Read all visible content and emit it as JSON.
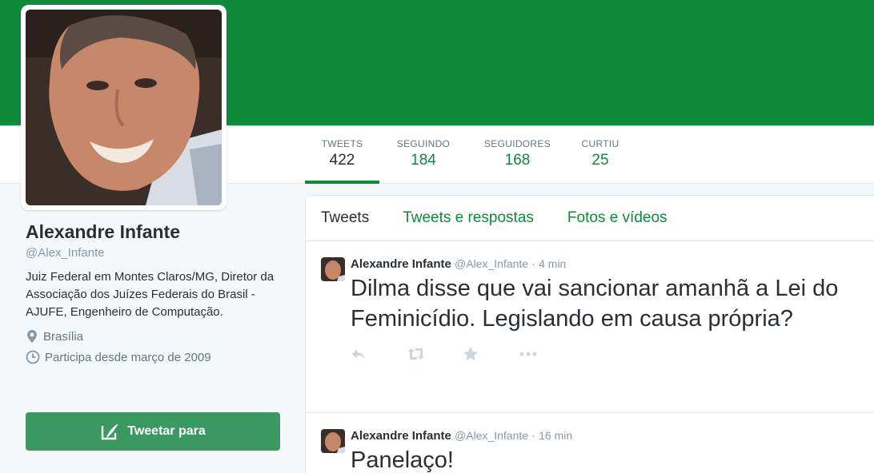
{
  "colors": {
    "brand": "#0e8a3c",
    "tweet_button": "#3b9860"
  },
  "profile": {
    "name": "Alexandre Infante",
    "handle": "@Alex_Infante",
    "bio": "Juiz Federal em Montes Claros/MG, Diretor da Associação dos Juízes Federais do Brasil - AJUFE, Engenheiro de Computação.",
    "location": "Brasília",
    "joined": "Participa desde março de 2009",
    "tweet_to_label": "Tweetar para"
  },
  "stats": [
    {
      "label": "TWEETS",
      "value": "422"
    },
    {
      "label": "SEGUINDO",
      "value": "184"
    },
    {
      "label": "SEGUIDORES",
      "value": "168"
    },
    {
      "label": "CURTIU",
      "value": "25"
    }
  ],
  "timeline_tabs": [
    "Tweets",
    "Tweets e respostas",
    "Fotos e vídeos"
  ],
  "tweets": [
    {
      "name": "Alexandre Infante",
      "handle": "@Alex_Infante",
      "separator": "·",
      "time": "4 min",
      "text": "Dilma disse que vai sancionar amanhã a Lei do Feminicídio. Legislando em causa própria?"
    },
    {
      "name": "Alexandre Infante",
      "handle": "@Alex_Infante",
      "separator": "·",
      "time": "16 min",
      "text": "Panelaço!"
    }
  ],
  "icons": {
    "location": "map-pin-icon",
    "joined": "clock-icon",
    "tweet_to": "compose-icon",
    "actions": [
      "reply-icon",
      "retweet-icon",
      "like-star-icon",
      "more-icon"
    ]
  }
}
